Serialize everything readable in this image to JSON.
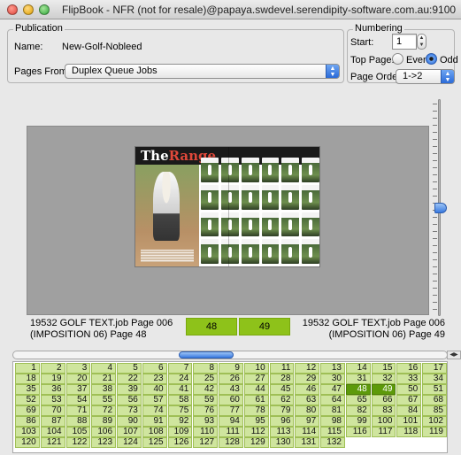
{
  "window": {
    "title": "FlipBook - NFR (not for resale)@papaya.swdevel.serendipity-software.com.au:9100"
  },
  "publication": {
    "legend": "Publication",
    "name_label": "Name:",
    "name_value": "New-Golf-Nobleed",
    "pages_from_label": "Pages From:",
    "pages_from_value": "Duplex Queue Jobs"
  },
  "numbering": {
    "legend": "Numbering",
    "start_label": "Start:",
    "start_value": "1",
    "top_page_label": "Top Page:",
    "even_label": "Even",
    "odd_label": "Odd",
    "selected_top_page": "Odd",
    "page_order_label": "Page Order",
    "page_order_value": "1->2"
  },
  "preview": {
    "magazine_title_a": "The",
    "magazine_title_b": "Range",
    "zoom_level": 0.52
  },
  "spread_info": {
    "left_line1": "19532 GOLF  TEXT.job Page 006",
    "left_line2": "(IMPOSITION 06) Page 48",
    "left_page": "48",
    "right_page": "49",
    "right_line1": "19532 GOLF  TEXT.job Page 006",
    "right_line2": "(IMPOSITION 06) Page 49"
  },
  "page_grid": {
    "first_page": 1,
    "last_page": 132,
    "columns": 17,
    "selected": [
      48,
      49
    ]
  },
  "colors": {
    "page_cell": "#cfe59e",
    "page_cell_selected": "#5d9a0a",
    "page_box": "#8ec21a",
    "accent_blue": "#3a7ae0"
  }
}
